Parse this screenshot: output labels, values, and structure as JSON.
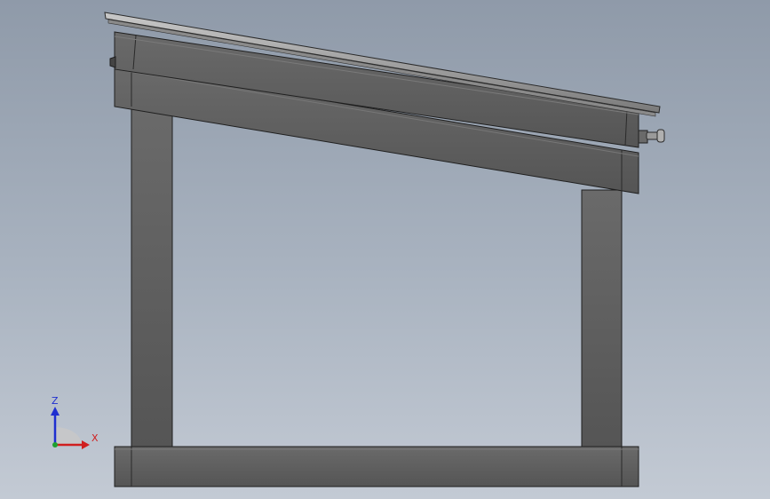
{
  "scene": {
    "view": "side elevation",
    "background_colors": [
      "#8f9aa9",
      "#c3cad4"
    ],
    "part_color": "#5e5e5e",
    "edge_color": "#1f1f1f",
    "panel_color": "#9a9a9a"
  },
  "triad": {
    "z_label": "Z",
    "x_label": "X",
    "z_color": "#1f2fd0",
    "x_color": "#d01f1f",
    "y_color": "#1fa02f"
  }
}
